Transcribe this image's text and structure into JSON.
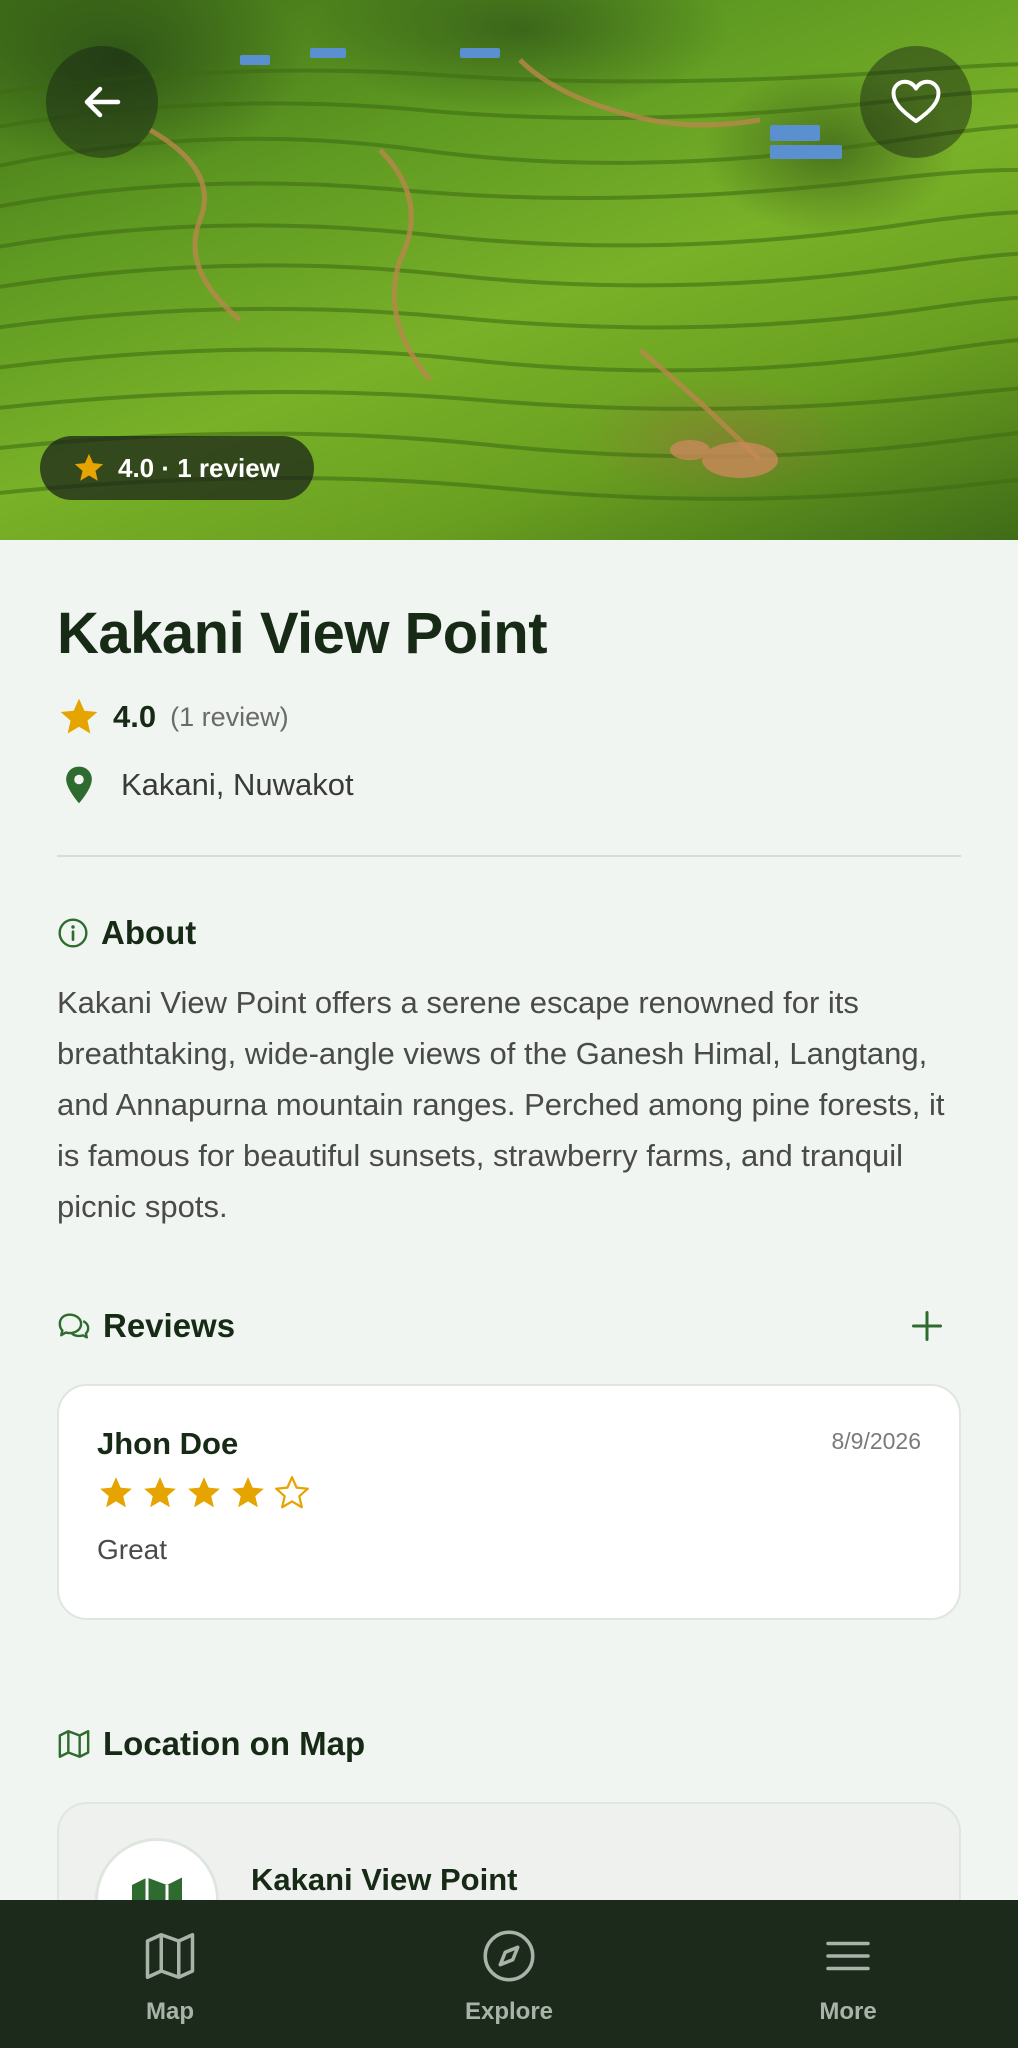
{
  "hero": {
    "rating_pill": "4.0 · 1 review",
    "back_icon": "arrow-left-icon",
    "favorite_icon": "heart-icon"
  },
  "place": {
    "name": "Kakani View Point",
    "rating": "4.0",
    "review_count": "(1 review)",
    "location": "Kakani, Nuwakot"
  },
  "about": {
    "heading": "About",
    "text": "Kakani View Point offers a serene escape renowned for its breathtaking, wide-angle views of the Ganesh Himal, Langtang, and Annapurna mountain ranges. Perched among pine forests, it is famous for beautiful sunsets, strawberry farms, and tranquil picnic spots."
  },
  "reviews": {
    "heading": "Reviews",
    "items": [
      {
        "author": "Jhon Doe",
        "date": "8/9/2026",
        "stars": 4,
        "max_stars": 5,
        "comment": "Great"
      }
    ]
  },
  "map": {
    "heading": "Location on Map",
    "place_name": "Kakani View Point"
  },
  "bottom_nav": {
    "items": [
      {
        "label": "Map",
        "icon": "map-icon"
      },
      {
        "label": "Explore",
        "icon": "compass-icon"
      },
      {
        "label": "More",
        "icon": "menu-icon"
      }
    ]
  },
  "colors": {
    "star": "#e6a400",
    "accent_green": "#2e6b2e",
    "nav_bg": "#1c2a1c",
    "title": "#162a16"
  }
}
